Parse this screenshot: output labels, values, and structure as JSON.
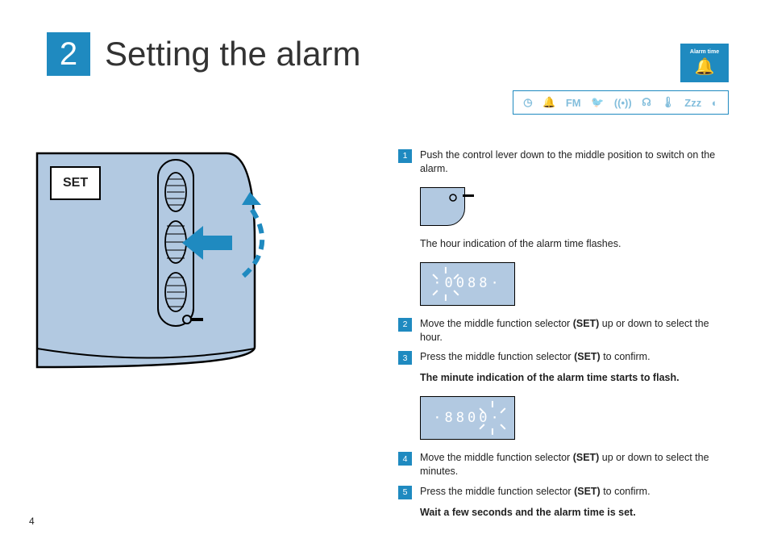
{
  "header": {
    "section_number": "2",
    "title": "Setting the alarm"
  },
  "badge": {
    "label": "Alarm time",
    "icon": "🔔"
  },
  "icon_bar": {
    "clock": "◷",
    "bell": "🔔",
    "fm": "FM",
    "bird": "🐦",
    "radio": "((•))",
    "sphere": "☊",
    "temp": "🌡",
    "zzz": "Zᴢᴢ",
    "contrast": "◐"
  },
  "illustration": {
    "set_label": "SET"
  },
  "steps": [
    {
      "num": "1",
      "text_before": "Push the control lever down to the middle position to switch on the alarm."
    },
    {
      "note1": "The hour indication of the alarm time flashes."
    },
    {
      "num": "2",
      "text_before": "Move the middle function selector ",
      "bold": "(SET)",
      "text_after": " up or down to select the hour."
    },
    {
      "num": "3",
      "text_before": "Press the middle function selector ",
      "bold": "(SET)",
      "text_after": " to confirm."
    },
    {
      "note2": "The minute indication of the alarm time starts to flash."
    },
    {
      "num": "4",
      "text_before": "Move the middle function selector ",
      "bold": "(SET)",
      "text_after": " up or down to select the minutes."
    },
    {
      "num": "5",
      "text_before": "Press the middle function selector ",
      "bold": "(SET)",
      "text_after": " to confirm."
    },
    {
      "note3": "Wait a few seconds and the alarm time is set."
    }
  ],
  "display": {
    "d1": "·0088·",
    "d2": "·8800·"
  },
  "page_number": "4"
}
